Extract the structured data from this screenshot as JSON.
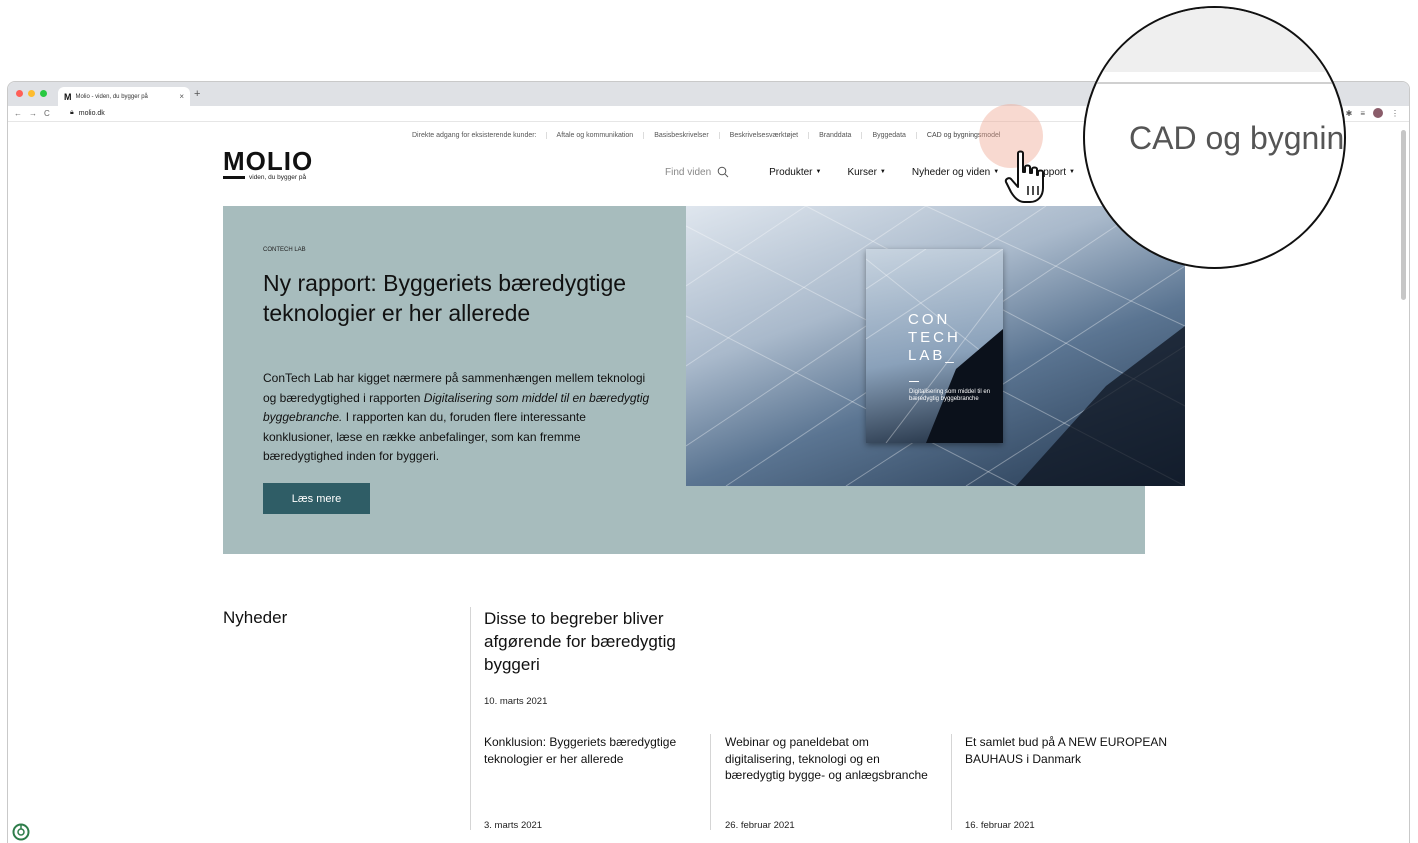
{
  "browser": {
    "tab_title": "Molio - viden, du bygger på",
    "tab_favicon": "M",
    "new_tab": "+",
    "tab_close": "×",
    "url": "molio.dk",
    "traffic_colors": [
      "#ff5f57",
      "#febc2e",
      "#28c840"
    ]
  },
  "utility_nav": {
    "lead": "Direkte adgang for eksisterende kunder:",
    "links": [
      "Aftale og kommunikation",
      "Basisbeskrivelser",
      "Beskrivelsesværktøjet",
      "Branddata",
      "Byggedata",
      "CAD og bygningsmodel"
    ]
  },
  "logo": {
    "word": "MOLIO",
    "tagline": "viden, du bygger på"
  },
  "main_nav": {
    "search_placeholder": "Find viden",
    "items": [
      "Produkter",
      "Kurser",
      "Nyheder og viden"
    ],
    "support_partial": "pport"
  },
  "hero": {
    "eyebrow": "CONTECH LAB",
    "title": "Ny rapport: Byggeriets bæredygtige teknologier er her allerede",
    "body_1": "ConTech Lab har kigget nærmere på sammenhængen mellem teknologi og bæredygtighed i rapporten ",
    "body_em": "Digitalisering som middel til en bæredygtig byggebranche.",
    "body_2": " I rapporten kan du, foruden flere interessante konklusioner, læse en række anbefalinger, som kan fremme bæredygtighed inden for byggeri.",
    "button": "Læs mere",
    "booklet_title_1": "CON",
    "booklet_title_2": "TECH",
    "booklet_title_3": "LAB_",
    "booklet_subtitle": "Digitalisering som middel til en bæredygtig byggebranche",
    "accent_color": "#2f5d66",
    "bg_color": "#a7bcbd"
  },
  "news": {
    "section_title": "Nyheder",
    "featured": {
      "title": "Disse to begreber bliver afgørende for bæredygtig byggeri",
      "date": "10. marts 2021"
    },
    "cards": [
      {
        "title": "Konklusion: Byggeriets bæredygtige teknologier er her allerede",
        "date": "3. marts 2021"
      },
      {
        "title": "Webinar og paneldebat om digitalisering, teknologi og en bæredygtig bygge- og anlægsbranche",
        "date": "26. februar 2021"
      },
      {
        "title": "Et samlet bud på A NEW EUROPEAN BAUHAUS i Danmark",
        "date": "16. februar 2021"
      }
    ]
  },
  "magnifier": {
    "text": "CAD og bygnin"
  }
}
